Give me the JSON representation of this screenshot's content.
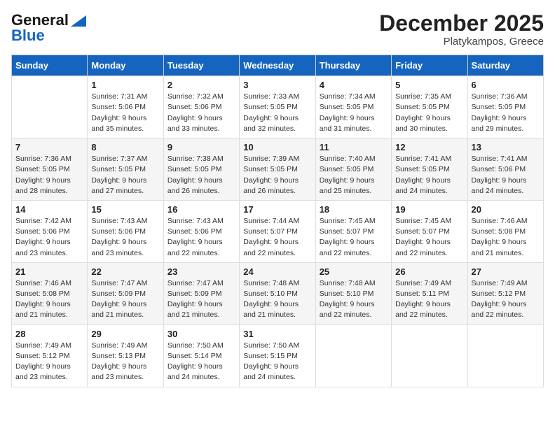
{
  "header": {
    "logo_line1": "General",
    "logo_line2": "Blue",
    "month": "December 2025",
    "location": "Platykampos, Greece"
  },
  "days_of_week": [
    "Sunday",
    "Monday",
    "Tuesday",
    "Wednesday",
    "Thursday",
    "Friday",
    "Saturday"
  ],
  "weeks": [
    [
      {
        "day": "",
        "info": ""
      },
      {
        "day": "1",
        "info": "Sunrise: 7:31 AM\nSunset: 5:06 PM\nDaylight: 9 hours\nand 35 minutes."
      },
      {
        "day": "2",
        "info": "Sunrise: 7:32 AM\nSunset: 5:06 PM\nDaylight: 9 hours\nand 33 minutes."
      },
      {
        "day": "3",
        "info": "Sunrise: 7:33 AM\nSunset: 5:05 PM\nDaylight: 9 hours\nand 32 minutes."
      },
      {
        "day": "4",
        "info": "Sunrise: 7:34 AM\nSunset: 5:05 PM\nDaylight: 9 hours\nand 31 minutes."
      },
      {
        "day": "5",
        "info": "Sunrise: 7:35 AM\nSunset: 5:05 PM\nDaylight: 9 hours\nand 30 minutes."
      },
      {
        "day": "6",
        "info": "Sunrise: 7:36 AM\nSunset: 5:05 PM\nDaylight: 9 hours\nand 29 minutes."
      }
    ],
    [
      {
        "day": "7",
        "info": "Sunrise: 7:36 AM\nSunset: 5:05 PM\nDaylight: 9 hours\nand 28 minutes."
      },
      {
        "day": "8",
        "info": "Sunrise: 7:37 AM\nSunset: 5:05 PM\nDaylight: 9 hours\nand 27 minutes."
      },
      {
        "day": "9",
        "info": "Sunrise: 7:38 AM\nSunset: 5:05 PM\nDaylight: 9 hours\nand 26 minutes."
      },
      {
        "day": "10",
        "info": "Sunrise: 7:39 AM\nSunset: 5:05 PM\nDaylight: 9 hours\nand 26 minutes."
      },
      {
        "day": "11",
        "info": "Sunrise: 7:40 AM\nSunset: 5:05 PM\nDaylight: 9 hours\nand 25 minutes."
      },
      {
        "day": "12",
        "info": "Sunrise: 7:41 AM\nSunset: 5:05 PM\nDaylight: 9 hours\nand 24 minutes."
      },
      {
        "day": "13",
        "info": "Sunrise: 7:41 AM\nSunset: 5:06 PM\nDaylight: 9 hours\nand 24 minutes."
      }
    ],
    [
      {
        "day": "14",
        "info": "Sunrise: 7:42 AM\nSunset: 5:06 PM\nDaylight: 9 hours\nand 23 minutes."
      },
      {
        "day": "15",
        "info": "Sunrise: 7:43 AM\nSunset: 5:06 PM\nDaylight: 9 hours\nand 23 minutes."
      },
      {
        "day": "16",
        "info": "Sunrise: 7:43 AM\nSunset: 5:06 PM\nDaylight: 9 hours\nand 22 minutes."
      },
      {
        "day": "17",
        "info": "Sunrise: 7:44 AM\nSunset: 5:07 PM\nDaylight: 9 hours\nand 22 minutes."
      },
      {
        "day": "18",
        "info": "Sunrise: 7:45 AM\nSunset: 5:07 PM\nDaylight: 9 hours\nand 22 minutes."
      },
      {
        "day": "19",
        "info": "Sunrise: 7:45 AM\nSunset: 5:07 PM\nDaylight: 9 hours\nand 22 minutes."
      },
      {
        "day": "20",
        "info": "Sunrise: 7:46 AM\nSunset: 5:08 PM\nDaylight: 9 hours\nand 21 minutes."
      }
    ],
    [
      {
        "day": "21",
        "info": "Sunrise: 7:46 AM\nSunset: 5:08 PM\nDaylight: 9 hours\nand 21 minutes."
      },
      {
        "day": "22",
        "info": "Sunrise: 7:47 AM\nSunset: 5:09 PM\nDaylight: 9 hours\nand 21 minutes."
      },
      {
        "day": "23",
        "info": "Sunrise: 7:47 AM\nSunset: 5:09 PM\nDaylight: 9 hours\nand 21 minutes."
      },
      {
        "day": "24",
        "info": "Sunrise: 7:48 AM\nSunset: 5:10 PM\nDaylight: 9 hours\nand 21 minutes."
      },
      {
        "day": "25",
        "info": "Sunrise: 7:48 AM\nSunset: 5:10 PM\nDaylight: 9 hours\nand 22 minutes."
      },
      {
        "day": "26",
        "info": "Sunrise: 7:49 AM\nSunset: 5:11 PM\nDaylight: 9 hours\nand 22 minutes."
      },
      {
        "day": "27",
        "info": "Sunrise: 7:49 AM\nSunset: 5:12 PM\nDaylight: 9 hours\nand 22 minutes."
      }
    ],
    [
      {
        "day": "28",
        "info": "Sunrise: 7:49 AM\nSunset: 5:12 PM\nDaylight: 9 hours\nand 23 minutes."
      },
      {
        "day": "29",
        "info": "Sunrise: 7:49 AM\nSunset: 5:13 PM\nDaylight: 9 hours\nand 23 minutes."
      },
      {
        "day": "30",
        "info": "Sunrise: 7:50 AM\nSunset: 5:14 PM\nDaylight: 9 hours\nand 24 minutes."
      },
      {
        "day": "31",
        "info": "Sunrise: 7:50 AM\nSunset: 5:15 PM\nDaylight: 9 hours\nand 24 minutes."
      },
      {
        "day": "",
        "info": ""
      },
      {
        "day": "",
        "info": ""
      },
      {
        "day": "",
        "info": ""
      }
    ]
  ]
}
